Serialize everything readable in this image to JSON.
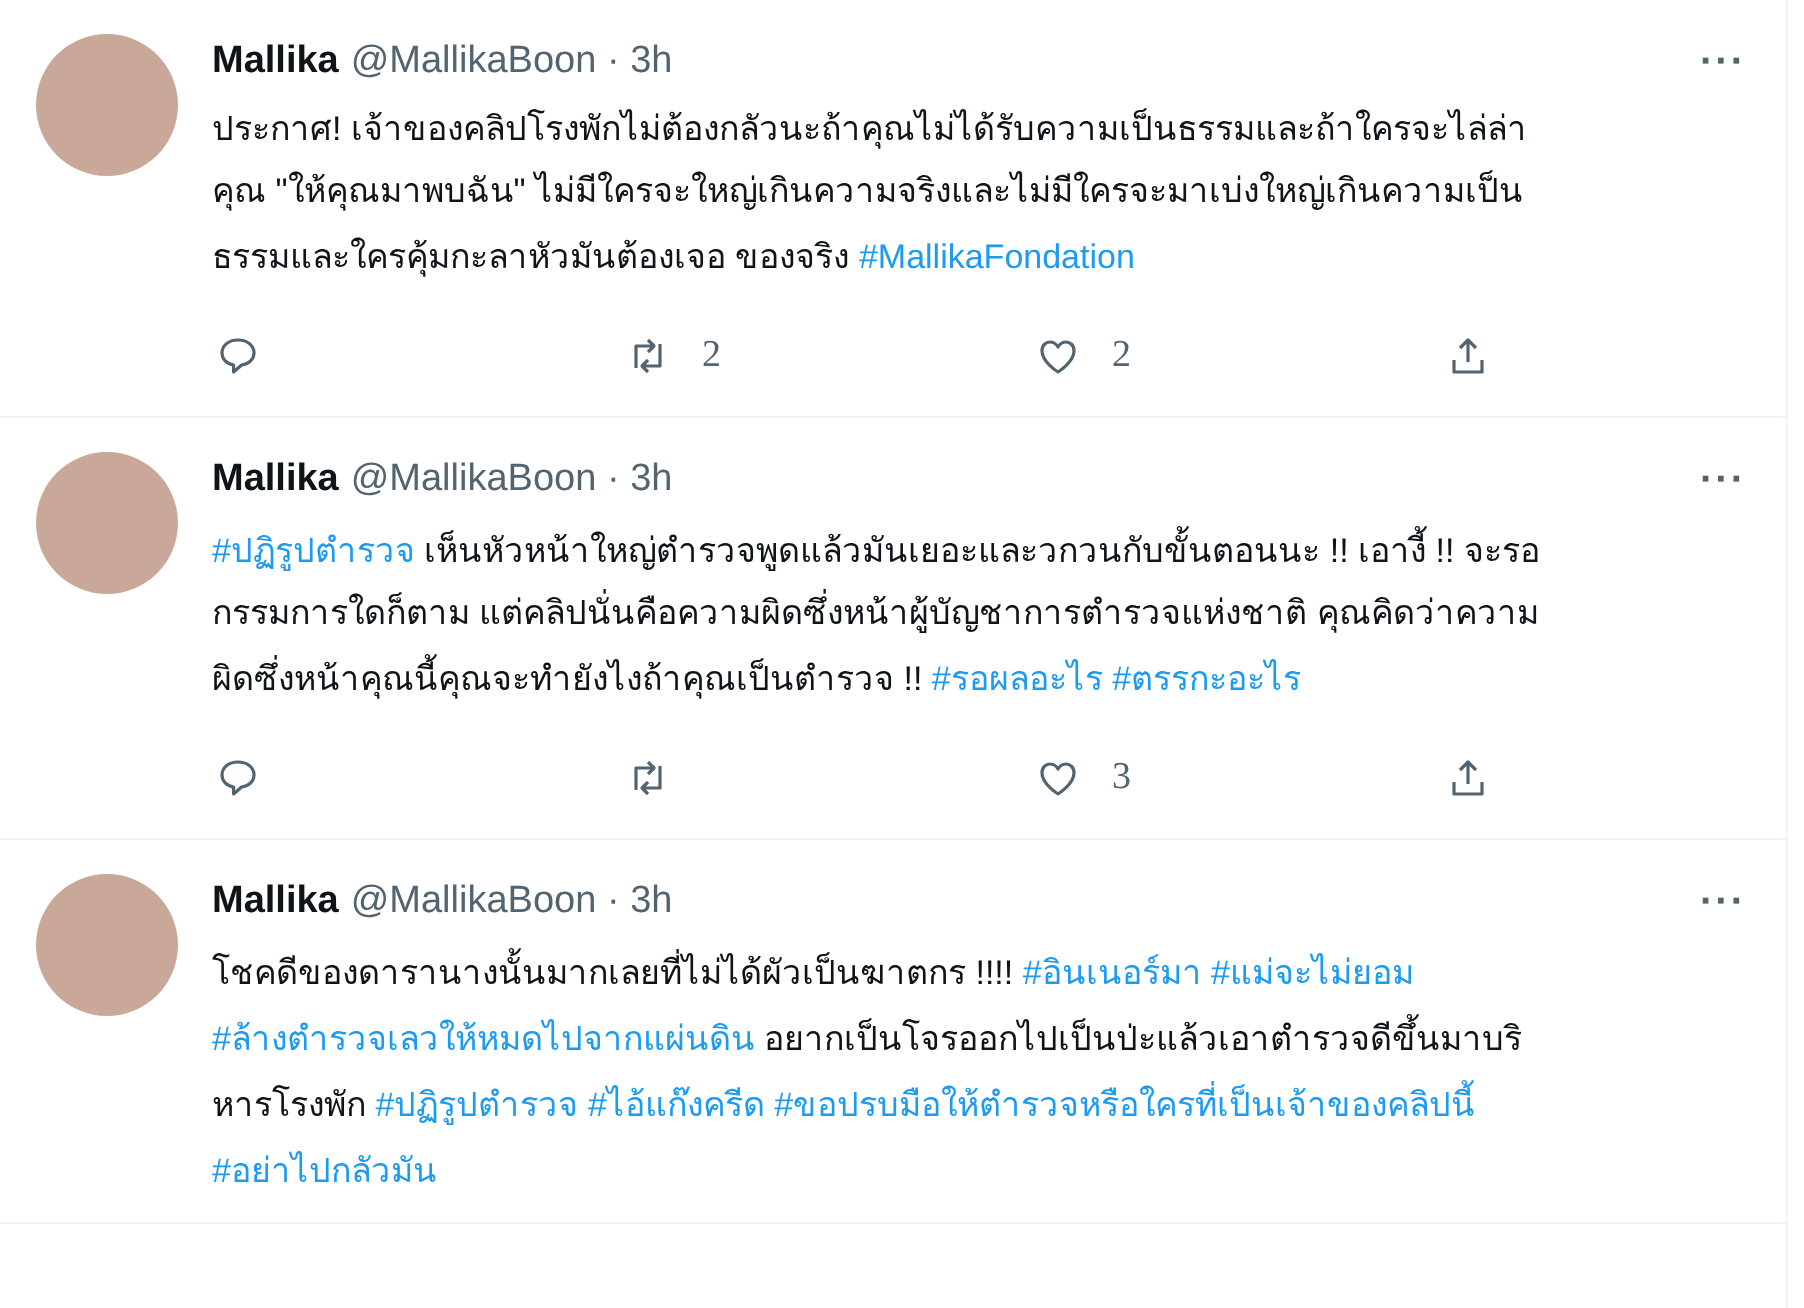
{
  "tweets": [
    {
      "name": "Mallika",
      "handle": "@MallikaBoon",
      "separator": "·",
      "time": "3h",
      "more": "···",
      "body": [
        {
          "kind": "text",
          "text": "ประกาศ! เจ้าของคลิปโรงพักไม่ต้องกลัวนะถ้าคุณไม่ได้รับความเป็นธรรมและถ้าใครจะไล่ล่าคุณ \"ให้คุณมาพบฉัน\" ไม่มีใครจะใหญ่เกินความจริงและไม่มีใครจะมาเบ่งใหญ่เกินความเป็นธรรมและใครคุ้มกะลาหัวมันต้องเจอ   ของจริง "
        },
        {
          "kind": "hashtag",
          "text": "#MallikaFondation"
        }
      ],
      "actions": {
        "retweets": "2",
        "likes": "2"
      }
    },
    {
      "name": "Mallika",
      "handle": "@MallikaBoon",
      "separator": "·",
      "time": "3h",
      "more": "···",
      "body": [
        {
          "kind": "hashtag",
          "text": "#ปฏิรูปตำรวจ"
        },
        {
          "kind": "text",
          "text": " เห็นหัวหน้าใหญ่ตำรวจพูดแล้วมันเยอะและวกวนกับขั้นตอนนะ !! เอางี้ !! จะรอกรรมการใดก็ตาม แต่คลิปนั่นคือความผิดซึ่งหน้าผู้บัญชาการตำรวจแห่งชาติ คุณคิดว่าความผิดซึ่งหน้าคุณนี้คุณจะทำยังไงถ้าคุณเป็นตำรวจ !! "
        },
        {
          "kind": "hashtag",
          "text": "#รอผลอะไร"
        },
        {
          "kind": "hashtag",
          "text": "#ตรรกะอะไร"
        }
      ],
      "actions": {
        "likes": "3"
      }
    },
    {
      "name": "Mallika",
      "handle": "@MallikaBoon",
      "separator": "·",
      "time": "3h",
      "more": "···",
      "body": [
        {
          "kind": "text",
          "text": "โชคดีของดารานางนั้นมากเลยที่ไม่ได้ผัวเป็นฆาตกร !!!!  "
        },
        {
          "kind": "hashtag",
          "text": "#อินเนอร์มา"
        },
        {
          "kind": "hashtag",
          "text": "#แม่จะไม่ยอม"
        },
        {
          "kind": "hashtag",
          "text": "#ล้างตำรวจเลวให้หมดไปจากแผ่นดิน"
        },
        {
          "kind": "text",
          "text": " อยากเป็นโจรออกไปเป็นป่ะแล้วเอาตำรวจดีขึ้นมาบริหารโรงพัก "
        },
        {
          "kind": "hashtag",
          "text": "#ปฏิรูปตำรวจ"
        },
        {
          "kind": "hashtag",
          "text": "#ไอ้แก๊งครีด"
        },
        {
          "kind": "hashtag",
          "text": "#ขอปรบมือให้ตำรวจหรือใครที่เป็นเจ้าของคลิปนี้"
        },
        {
          "kind": "hashtag",
          "text": "#อย่าไปกลัวมัน"
        }
      ]
    }
  ]
}
